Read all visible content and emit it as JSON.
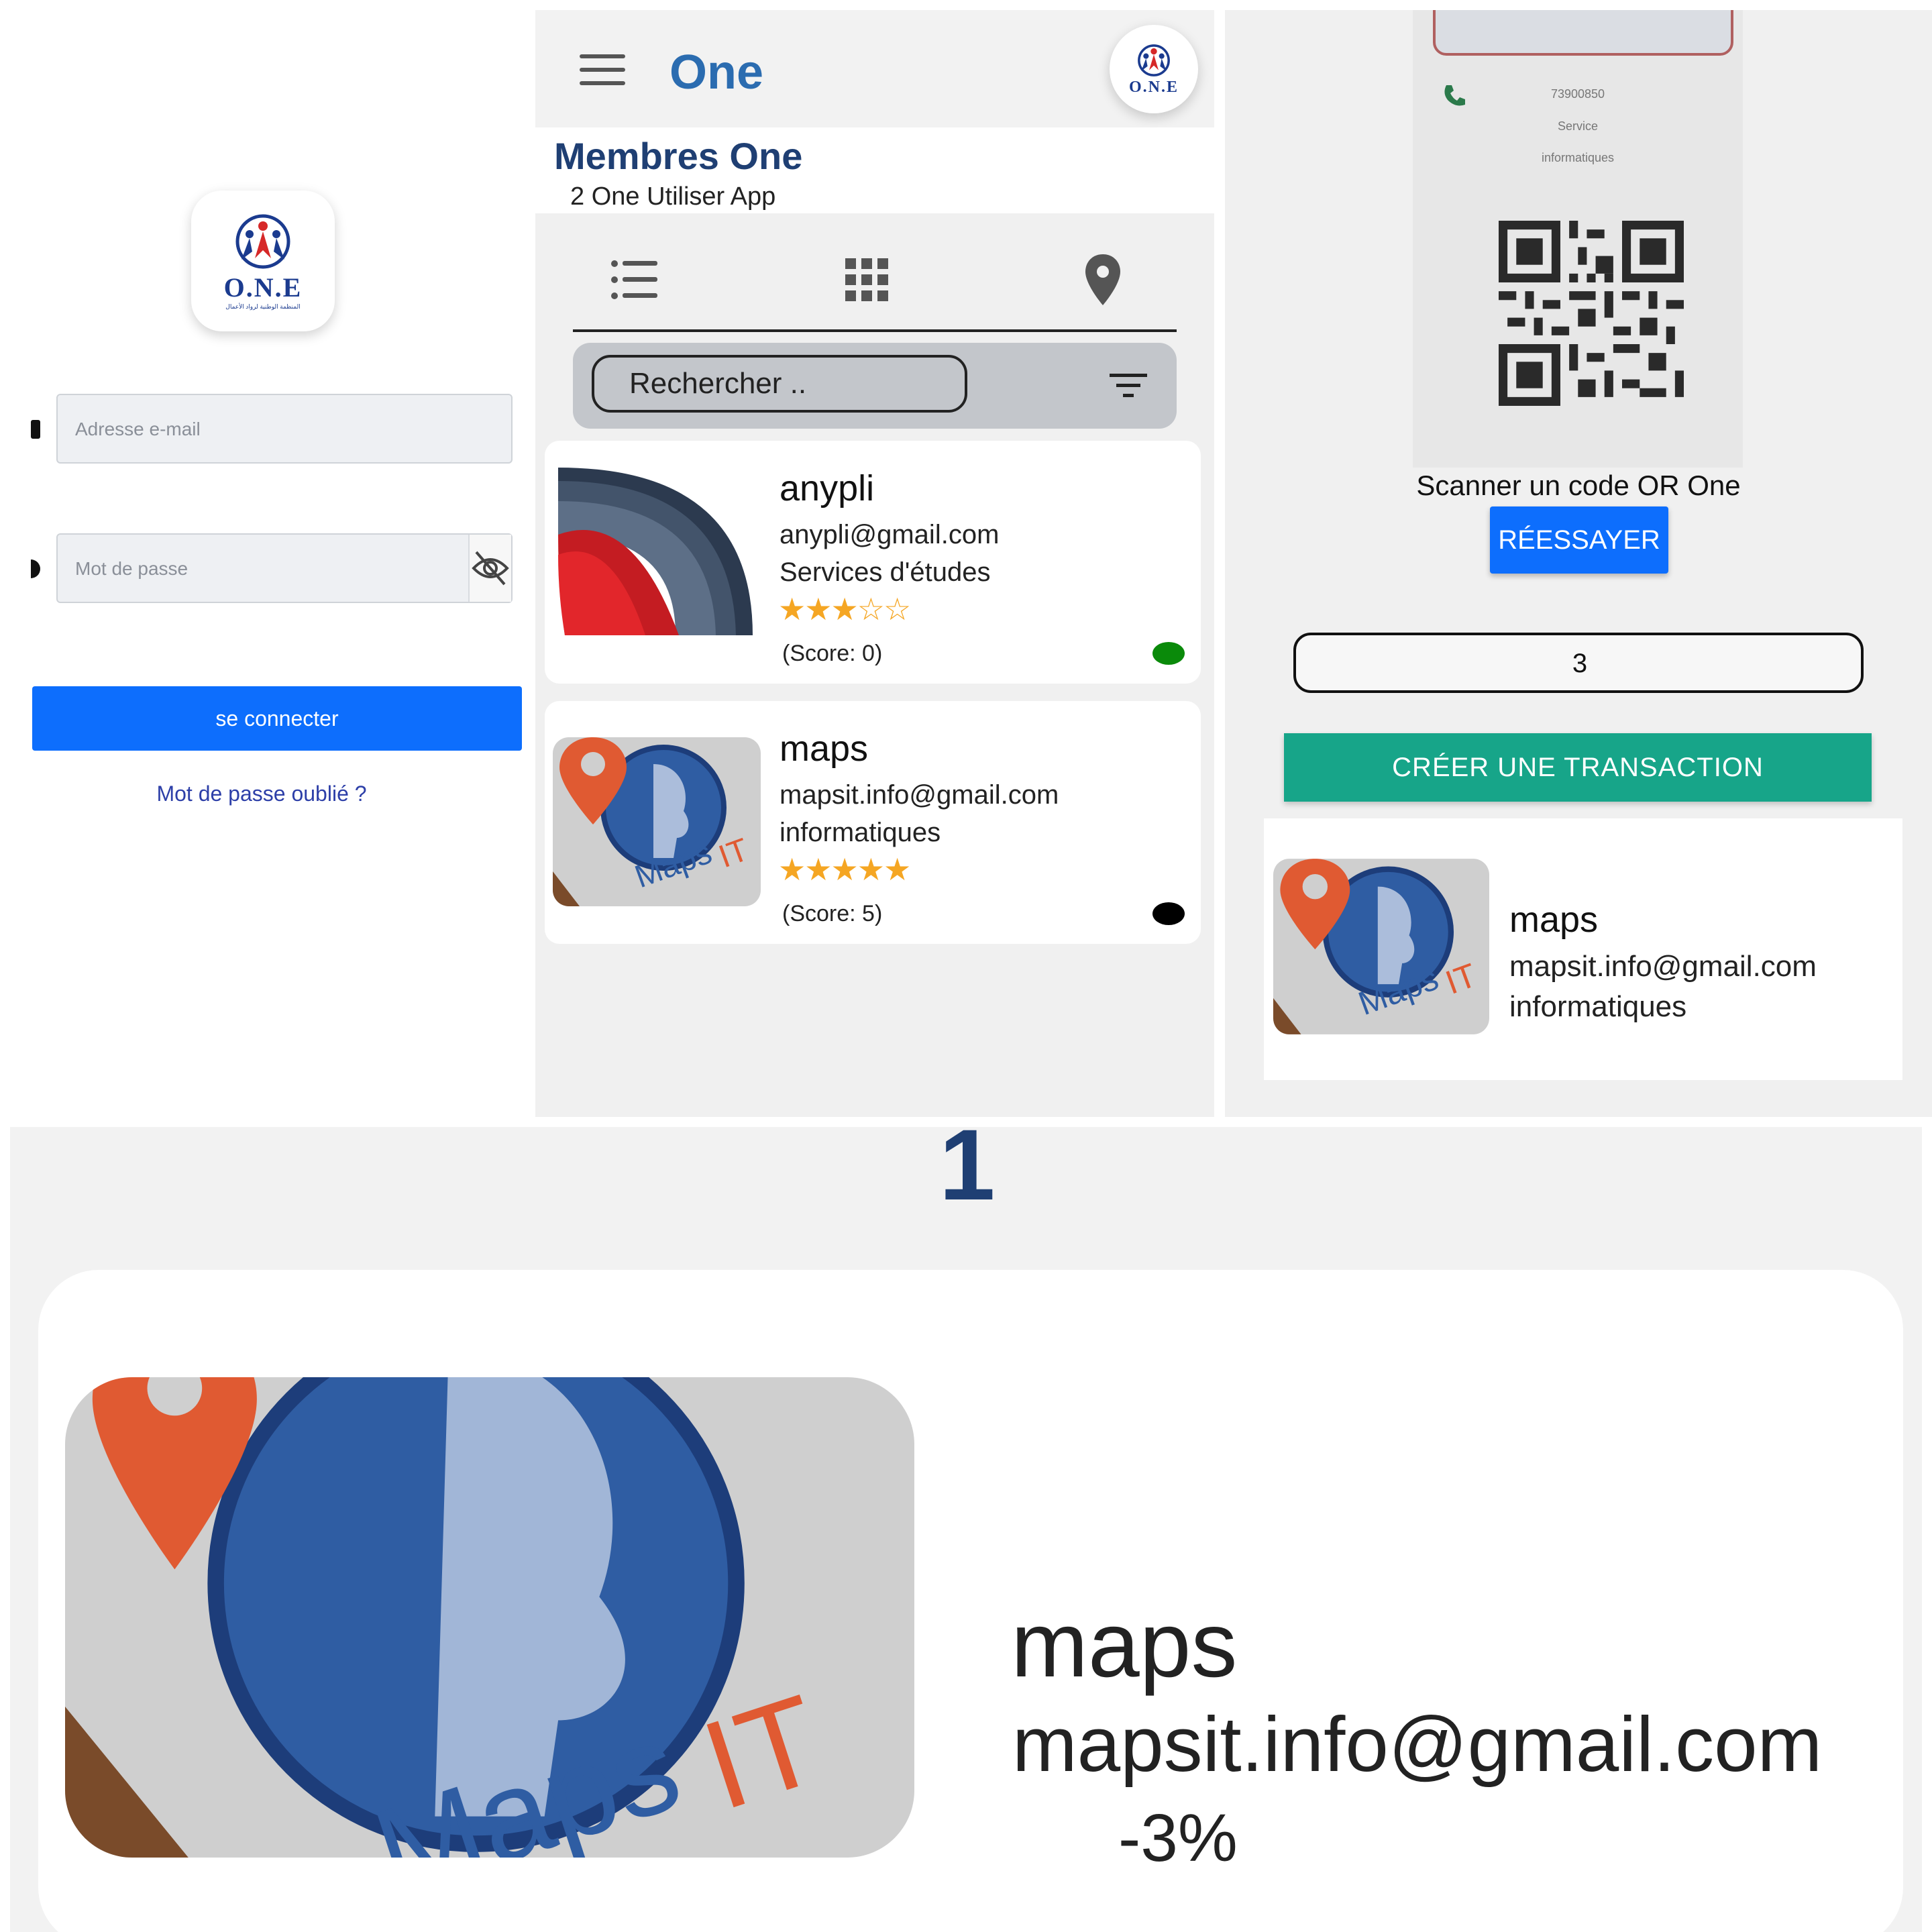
{
  "colors": {
    "primary_blue": "#0d6efd",
    "title_blue": "#2b6cb0",
    "navy": "#1f3f73",
    "link_blue": "#2d3fa8",
    "teal": "#17a589",
    "star_orange": "#f5a623",
    "status_active": "#0a8a0a",
    "status_inactive": "#000000"
  },
  "logo": {
    "text": "O.N.E",
    "sub": "المنظمة الوطنية لرواد الأعمال"
  },
  "login": {
    "email_placeholder": "Adresse e-mail",
    "password_placeholder": "Mot de passe",
    "submit_label": "se connecter",
    "forgot_label": "Mot de passe oublié ?"
  },
  "members": {
    "app_title": "One",
    "title": "Membres One",
    "subtitle": "2 One Utiliser App",
    "view_icons": [
      "list-icon",
      "grid-icon",
      "map-pin-icon"
    ],
    "search_placeholder": "Rechercher ..",
    "items": [
      {
        "name": "anypli",
        "email": "anypli@gmail.com",
        "category": "Services d'études",
        "rating": 3,
        "stars": "★★★☆☆",
        "score": "(Score: 0)",
        "status": "active"
      },
      {
        "name": "maps",
        "email": "mapsit.info@gmail.com",
        "category": "informatiques",
        "rating": 5,
        "stars": "★★★★★",
        "score": "(Score: 5)",
        "status": "inactive"
      }
    ]
  },
  "scan": {
    "card_phone": "73900850",
    "card_line1": "Service",
    "card_line2": "informatiques",
    "caption": "Scanner un code OR One",
    "retry_label": "RÉESSAYER",
    "amount_value": "3",
    "create_label": "CRÉER UNE TRANSACTION",
    "result": {
      "name": "maps",
      "email": "mapsit.info@gmail.com",
      "category": "informatiques"
    }
  },
  "detail": {
    "step": "1",
    "name": "maps",
    "email": "mapsit.info@gmail.com",
    "discount": "-3%"
  }
}
